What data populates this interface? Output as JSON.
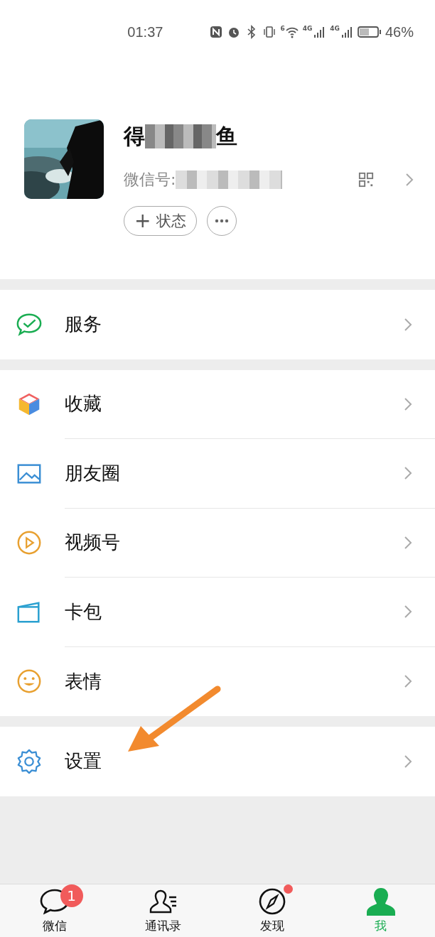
{
  "status_bar": {
    "time": "01:37",
    "network_labels": [
      "4G",
      "4G"
    ],
    "wifi_label": "6",
    "battery": "46%"
  },
  "profile": {
    "name_parts": [
      "得",
      "鱼"
    ],
    "id_label": "微信号:",
    "status_button": "状态",
    "status_icon": "+"
  },
  "groups": [
    [
      {
        "kind": "service",
        "label": "服务"
      }
    ],
    [
      {
        "kind": "favorites",
        "label": "收藏"
      },
      {
        "kind": "moments",
        "label": "朋友圈"
      },
      {
        "kind": "channels",
        "label": "视频号"
      },
      {
        "kind": "cards",
        "label": "卡包"
      },
      {
        "kind": "stickers",
        "label": "表情"
      }
    ],
    [
      {
        "kind": "settings",
        "label": "设置"
      }
    ]
  ],
  "tabbar": [
    {
      "kind": "chats",
      "label": "微信",
      "selected": false,
      "badge": "1",
      "dot": false
    },
    {
      "kind": "contacts",
      "label": "通讯录",
      "selected": false,
      "dot": false
    },
    {
      "kind": "discover",
      "label": "发现",
      "selected": false,
      "dot": true
    },
    {
      "kind": "me",
      "label": "我",
      "selected": true,
      "dot": false
    }
  ]
}
